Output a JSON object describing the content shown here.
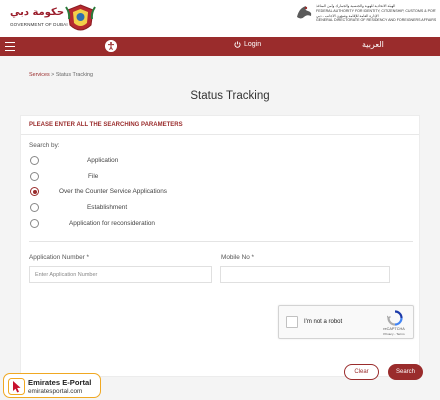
{
  "header": {
    "dubai_logo_arabic": "حكومة دبي",
    "dubai_logo_english": "GOVERNMENT OF DUBAI",
    "gdrfa_lines": [
      "الهيئة الاتحادية للهوية والجنسية والجمارك وأمن المنافذ",
      "FEDERAL AUTHORITY FOR IDENTITY, CITIZENSHIP, CUSTOMS & PORT SECURITY",
      "الإدارة العامة للإقامة وشؤون الأجانب - دبي",
      "GENERAL DIRECTORATE OF RESIDENCY AND FOREIGNERS AFFAIRS - DUBAI"
    ]
  },
  "nav": {
    "login_label": "Login",
    "language_label": "العربية"
  },
  "breadcrumb": {
    "root": "Services",
    "separator": " > ",
    "current": "Status Tracking"
  },
  "page_title": "Status Tracking",
  "form": {
    "header": "PLEASE ENTER ALL THE SEARCHING PARAMETERS",
    "search_by_label": "Search by:",
    "options": [
      {
        "label": "Application",
        "checked": false
      },
      {
        "label": "File",
        "checked": false
      },
      {
        "label": "Over the Counter Service Applications",
        "checked": true
      },
      {
        "label": "Establishment",
        "checked": false
      },
      {
        "label": "Application for reconsideration",
        "checked": false
      }
    ],
    "application_number": {
      "label": "Application Number *",
      "placeholder": "Enter Application Number",
      "value": ""
    },
    "mobile_no": {
      "label": "Mobile No *",
      "placeholder": "",
      "value": ""
    },
    "recaptcha": {
      "label": "I'm not a robot",
      "brand": "reCAPTCHA",
      "terms": "Privacy - Terms"
    },
    "clear_label": "Clear",
    "search_label": "Search"
  },
  "watermark": {
    "title": "Emirates E-Portal",
    "url": "emiratesportal.com"
  },
  "colors": {
    "brand": "#9a2c2c",
    "background": "#f4f4f4",
    "watermark_border": "#f0a822"
  },
  "icons": {
    "menu": "hamburger-menu-icon",
    "accessibility": "accessibility-icon",
    "login": "power-icon",
    "recaptcha": "recaptcha-logo-icon"
  }
}
